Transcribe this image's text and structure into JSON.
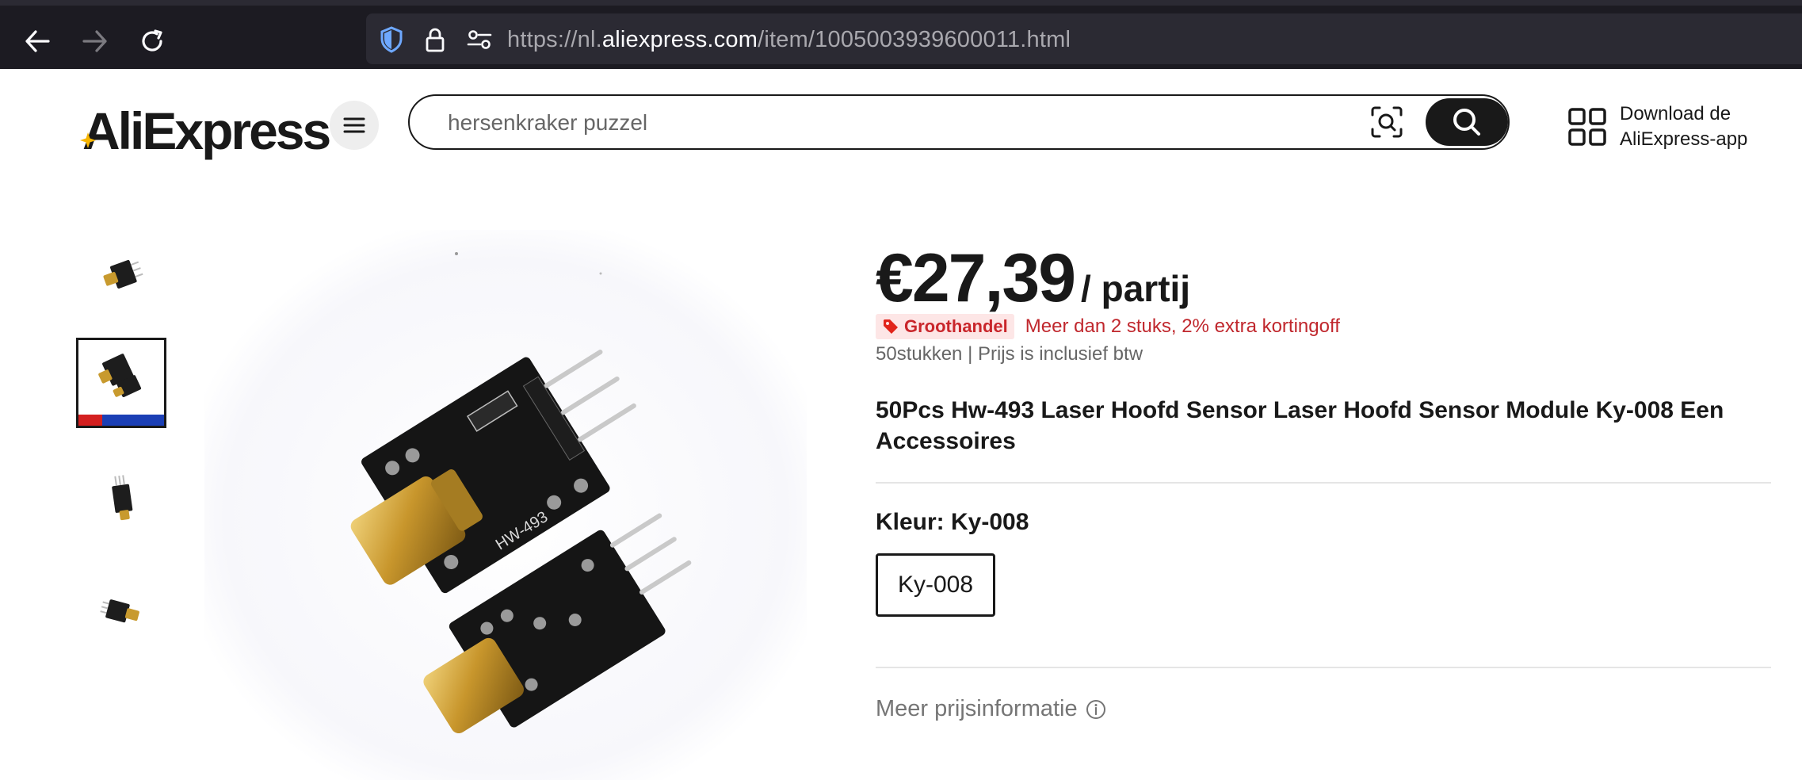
{
  "browser": {
    "url_prefix": "https://nl.",
    "url_host": "aliexpress.com",
    "url_path": "/item/1005003939600011.html"
  },
  "header": {
    "logo_text": "AliExpress",
    "search": {
      "placeholder": "hersenkraker puzzel"
    },
    "app_download": {
      "line1": "Download de",
      "line2": "AliExpress-app"
    }
  },
  "product": {
    "price": "€27,39",
    "unit": "/ partij",
    "badge_label": "Groothandel",
    "promo_text": "Meer dan 2 stuks, 2% extra kortingoff",
    "sub_info": "50stukken | Prijs is inclusief btw",
    "title": "50Pcs Hw-493 Laser Hoofd Sensor Laser Hoofd Sensor Module Ky-008 Een Accessoires",
    "color_label": "Kleur: Ky-008",
    "options": [
      "Ky-008"
    ],
    "price_info_label": "Meer prijsinformatie"
  },
  "gallery": {
    "thumbnail_count": 4,
    "active_thumbnail": 2,
    "main_image_module_label": "HW-493"
  },
  "colors": {
    "browser_bg": "#1c1b22",
    "url_bg": "#2b2a33",
    "brand_dark": "#191919",
    "promo_red": "#c0272d",
    "badge_bg": "#fde6e6"
  }
}
